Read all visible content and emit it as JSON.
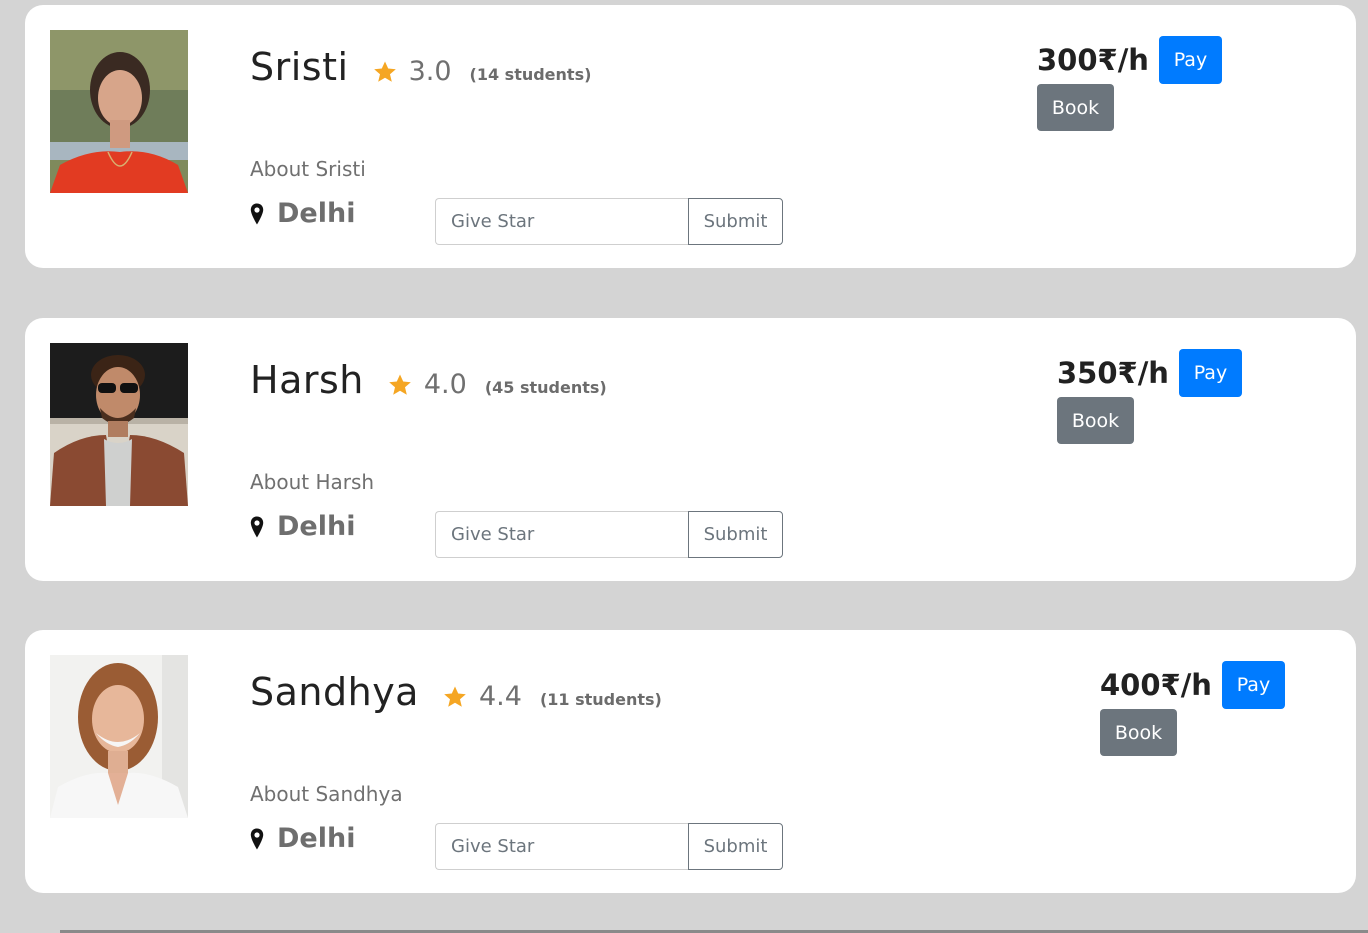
{
  "tutors": [
    {
      "name": "Sristi",
      "rating": "3.0",
      "students": "(14 students)",
      "about": "About Sristi",
      "city": "Delhi",
      "star_placeholder": "Give Star",
      "submit_label": "Submit",
      "price": "300₹/h",
      "pay_label": "Pay",
      "book_label": "Book"
    },
    {
      "name": "Harsh",
      "rating": "4.0",
      "students": "(45 students)",
      "about": "About Harsh",
      "city": "Delhi",
      "star_placeholder": "Give Star",
      "submit_label": "Submit",
      "price": "350₹/h",
      "pay_label": "Pay",
      "book_label": "Book"
    },
    {
      "name": "Sandhya",
      "rating": "4.4",
      "students": "(11 students)",
      "about": "About Sandhya",
      "city": "Delhi",
      "star_placeholder": "Give Star",
      "submit_label": "Submit",
      "price": "400₹/h",
      "pay_label": "Pay",
      "book_label": "Book"
    }
  ],
  "icons": {
    "rating": "star-icon",
    "location": "map-pin-icon"
  },
  "colors": {
    "background": "#d4d4d4",
    "card": "#ffffff",
    "star": "#f5a623",
    "pay_button": "#007bff",
    "book_button": "#6c757d"
  }
}
